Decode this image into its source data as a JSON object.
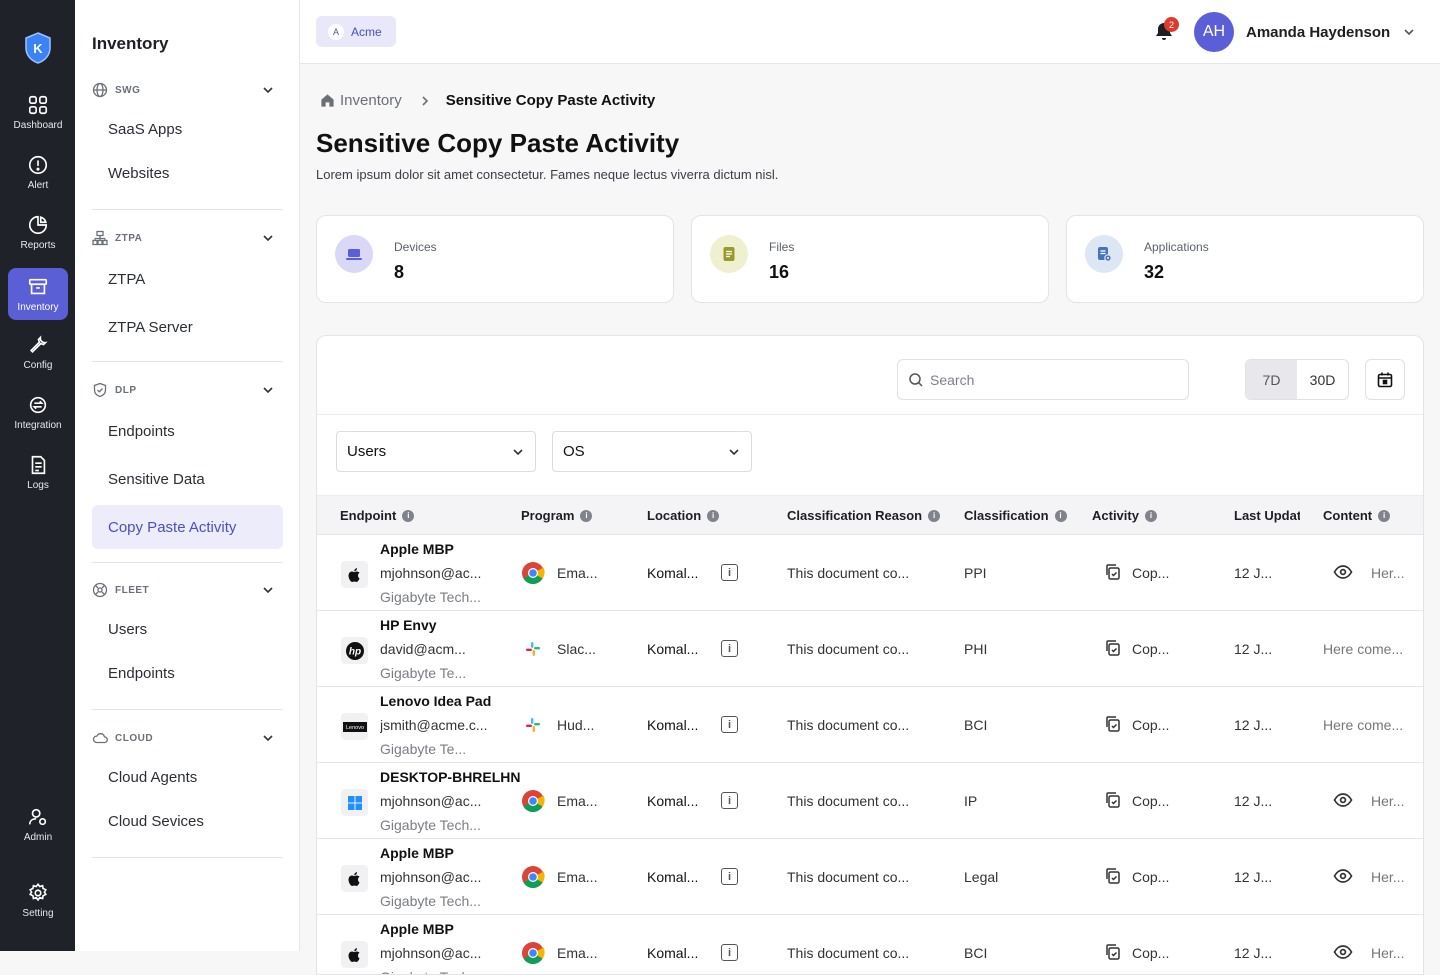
{
  "rail": {
    "items": [
      {
        "label": "Dashboard",
        "icon": "grid-icon"
      },
      {
        "label": "Alert",
        "icon": "alert-icon"
      },
      {
        "label": "Reports",
        "icon": "pie-chart-icon"
      },
      {
        "label": "Inventory",
        "icon": "archive-icon",
        "active": true
      },
      {
        "label": "Config",
        "icon": "wrench-icon"
      },
      {
        "label": "Integration",
        "icon": "integration-icon"
      },
      {
        "label": "Logs",
        "icon": "logs-icon"
      },
      {
        "label": "Admin",
        "icon": "admin-icon"
      },
      {
        "label": "Setting",
        "icon": "gear-icon"
      }
    ]
  },
  "sidebar": {
    "title": "Inventory",
    "sections": [
      {
        "label": "SWG",
        "icon": "globe-icon",
        "items": [
          "SaaS Apps",
          "Websites"
        ]
      },
      {
        "label": "ZTPA",
        "icon": "network-icon",
        "items": [
          "ZTPA",
          "ZTPA Server"
        ]
      },
      {
        "label": "DLP",
        "icon": "shield-icon",
        "items": [
          "Endpoints",
          "Sensitive Data",
          "Copy Paste Activity"
        ]
      },
      {
        "label": "FLEET",
        "icon": "fleet-icon",
        "items": [
          "Users",
          "Endpoints"
        ]
      },
      {
        "label": "CLOUD",
        "icon": "cloud-icon",
        "items": [
          "Cloud Agents",
          "Cloud Sevices"
        ]
      }
    ],
    "active_item": "Copy Paste Activity"
  },
  "topbar": {
    "org": "Acme",
    "org_initial": "A",
    "notifications": "2",
    "avatar_initials": "AH",
    "user_name": "Amanda Haydenson"
  },
  "breadcrumb": {
    "root": "Inventory",
    "current": "Sensitive Copy Paste Activity"
  },
  "page": {
    "title": "Sensitive Copy Paste Activity",
    "description": "Lorem ipsum dolor sit amet consectetur. Fames neque lectus viverra dictum nisl."
  },
  "stats": [
    {
      "label": "Devices",
      "value": "8",
      "color": "#d9d8f6"
    },
    {
      "label": "Files",
      "value": "16",
      "color": "#eef0cf"
    },
    {
      "label": "Applications",
      "value": "32",
      "color": "#dde6f4"
    }
  ],
  "toolbar": {
    "search_placeholder": "Search",
    "range_7d": "7D",
    "range_30d": "30D"
  },
  "filters": {
    "users": "Users",
    "os": "OS"
  },
  "table": {
    "columns": [
      "Endpoint",
      "Program",
      "Location",
      "Classification Reason",
      "Classification",
      "Activity",
      "Last Updated",
      "Content"
    ],
    "rows": [
      {
        "device": "Apple MBP",
        "email": "mjohnson@ac...",
        "org": "Gigabyte Tech...",
        "program": "Ema...",
        "location": "Komal...",
        "reason": "This document co...",
        "classification": "PPI",
        "activity": "Cop...",
        "updated": "12 J...",
        "content": "Her...",
        "os": "apple",
        "app": "chrome",
        "eye": true
      },
      {
        "device": "HP Envy",
        "email": "david@acm...",
        "org": "Gigabyte Te...",
        "program": "Slac...",
        "location": "Komal...",
        "reason": "This document co...",
        "classification": "PHI",
        "activity": "Cop...",
        "updated": "12 J...",
        "content": "Here come...",
        "os": "hp",
        "app": "slack",
        "eye": false
      },
      {
        "device": "Lenovo Idea Pad",
        "email": "jsmith@acme.c...",
        "org": "Gigabyte Te...",
        "program": "Hud...",
        "location": "Komal...",
        "reason": "This document co...",
        "classification": "BCI",
        "activity": "Cop...",
        "updated": "12 J...",
        "content": "Here come...",
        "os": "lenovo",
        "app": "slack",
        "eye": false
      },
      {
        "device": "DESKTOP-BHRELHN",
        "email": "mjohnson@ac...",
        "org": "Gigabyte Tech...",
        "program": "Ema...",
        "location": "Komal...",
        "reason": "This document co...",
        "classification": "IP",
        "activity": "Cop...",
        "updated": "12 J...",
        "content": "Her...",
        "os": "windows",
        "app": "chrome",
        "eye": true
      },
      {
        "device": "Apple MBP",
        "email": "mjohnson@ac...",
        "org": "Gigabyte Tech...",
        "program": "Ema...",
        "location": "Komal...",
        "reason": "This document co...",
        "classification": "Legal",
        "activity": "Cop...",
        "updated": "12 J...",
        "content": "Her...",
        "os": "apple",
        "app": "chrome",
        "eye": true
      },
      {
        "device": "Apple MBP",
        "email": "mjohnson@ac...",
        "org": "Gigabyte Tech...",
        "program": "Ema...",
        "location": "Komal...",
        "reason": "This document co...",
        "classification": "BCI",
        "activity": "Cop...",
        "updated": "12 J...",
        "content": "Her...",
        "os": "apple",
        "app": "chrome",
        "eye": true
      }
    ]
  }
}
